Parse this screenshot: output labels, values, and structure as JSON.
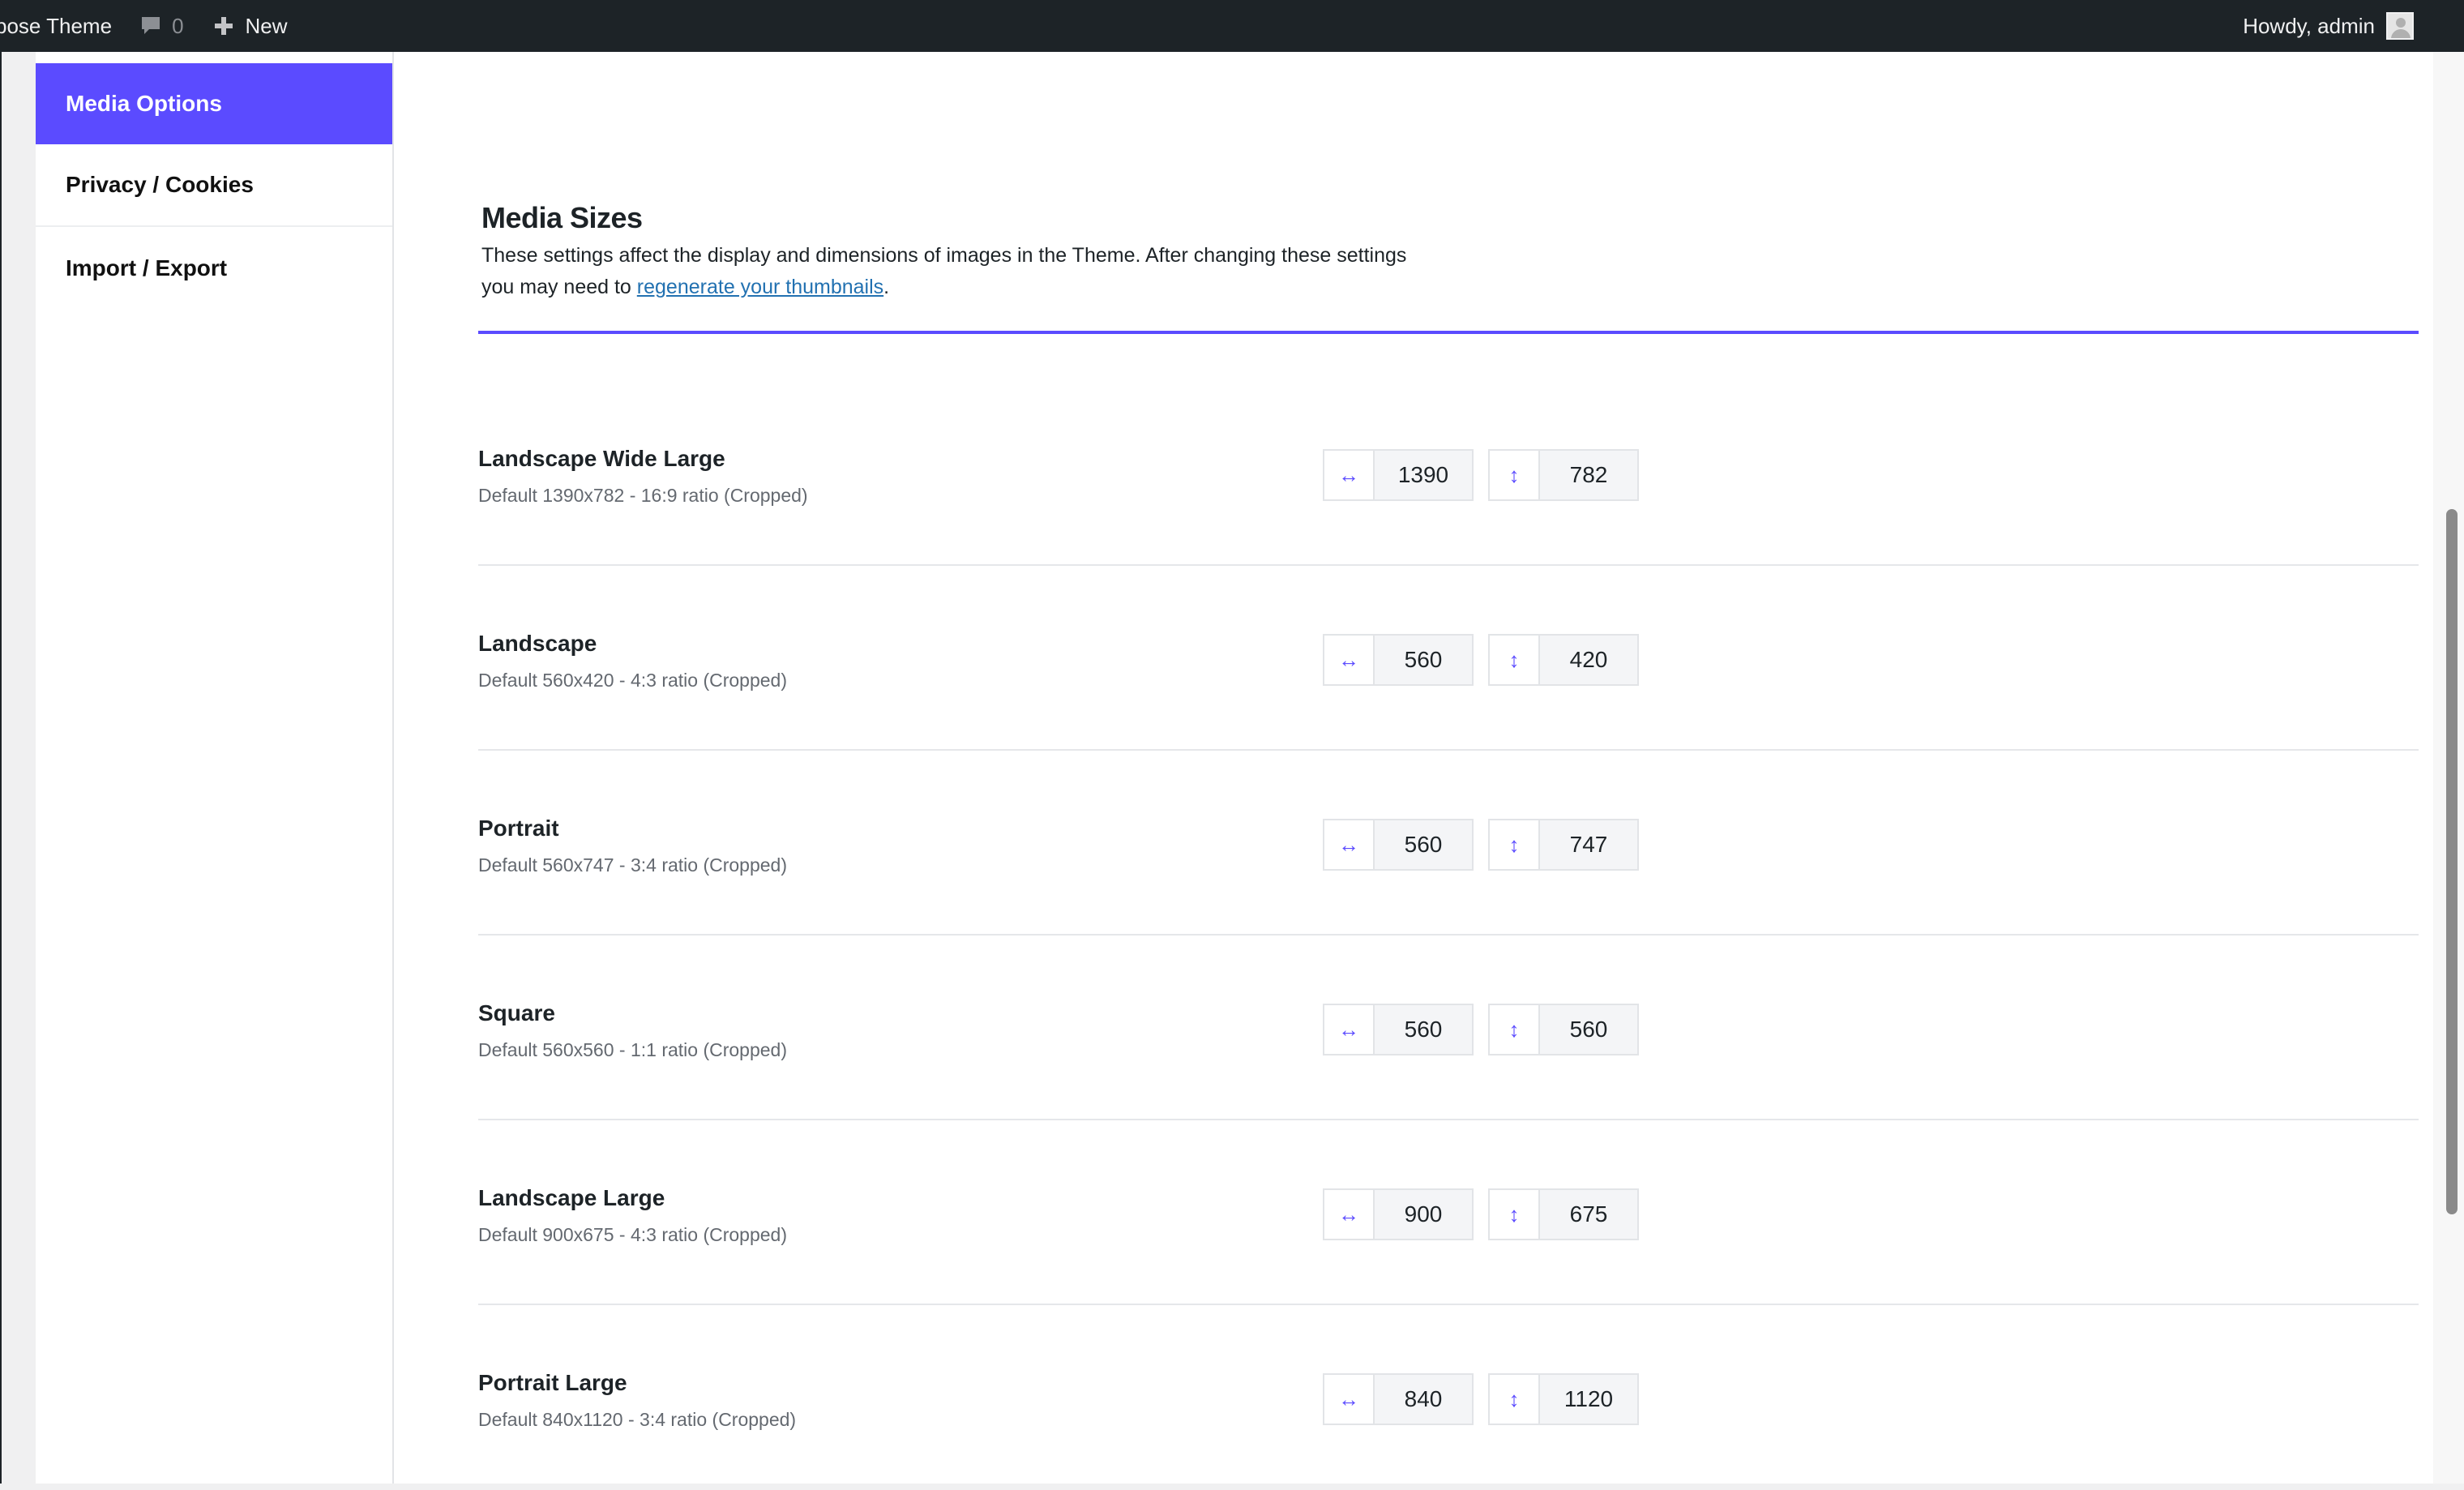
{
  "adminbar": {
    "site_title": "pose Theme",
    "comments_count": "0",
    "new_label": "New",
    "greeting": "Howdy, admin"
  },
  "tabs": [
    {
      "label": "Media Options",
      "active": true
    },
    {
      "label": "Privacy / Cookies",
      "active": false
    },
    {
      "label": "Import / Export",
      "active": false
    }
  ],
  "section": {
    "title": "Media Sizes",
    "desc_line1": "These settings affect the display and dimensions of images in the Theme. After changing these settings",
    "desc_line2_pre": "you may need to ",
    "desc_link": "regenerate your thumbnails",
    "desc_line2_post": "."
  },
  "sizes": [
    {
      "label": "Landscape Wide Large",
      "desc": "Default 1390x782 - 16:9 ratio (Cropped)",
      "width": "1390",
      "height": "782"
    },
    {
      "label": "Landscape",
      "desc": "Default 560x420 - 4:3 ratio (Cropped)",
      "width": "560",
      "height": "420"
    },
    {
      "label": "Portrait",
      "desc": "Default 560x747 - 3:4 ratio (Cropped)",
      "width": "560",
      "height": "747"
    },
    {
      "label": "Square",
      "desc": "Default 560x560 - 1:1 ratio (Cropped)",
      "width": "560",
      "height": "560"
    },
    {
      "label": "Landscape Large",
      "desc": "Default 900x675 - 4:3 ratio (Cropped)",
      "width": "900",
      "height": "675"
    },
    {
      "label": "Portrait Large",
      "desc": "Default 840x1120 - 3:4 ratio (Cropped)",
      "width": "840",
      "height": "1120"
    }
  ],
  "icons": {
    "width_icon": "↔",
    "height_icon": "↕"
  },
  "colors": {
    "accent": "#5b4bff",
    "adminbar": "#1d2327",
    "link": "#2271b1"
  }
}
